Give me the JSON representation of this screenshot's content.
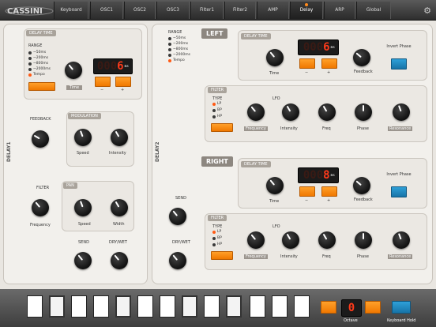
{
  "app": {
    "logo_text": "CASSINI"
  },
  "tabs": [
    {
      "label": "Keyboard",
      "active": false
    },
    {
      "label": "OSC1",
      "active": false
    },
    {
      "label": "OSC2",
      "active": false
    },
    {
      "label": "OSC3",
      "active": false
    },
    {
      "label": "Filter1",
      "active": false
    },
    {
      "label": "Filter2",
      "active": false
    },
    {
      "label": "AMP",
      "active": false
    },
    {
      "label": "Delay",
      "active": true
    },
    {
      "label": "ARP",
      "active": false
    },
    {
      "label": "Global",
      "active": false
    }
  ],
  "delay1": {
    "side_title": "DELAY1",
    "delay_time_header": "DELAY TIME",
    "range_label": "RANGE",
    "range_options": [
      "~50ms",
      "~200ms",
      "~800ms",
      "~2000ms",
      "Tempo"
    ],
    "range_selected": "Tempo",
    "time_label": "Time",
    "time_display_ghost": "000",
    "time_display_value": "6",
    "time_unit": "ms",
    "minus": "−",
    "plus": "+",
    "feedback_label": "FEEDBACK",
    "modulation_header": "MODULATION",
    "speed_label": "Speed",
    "intensity_label": "Intensity",
    "filter_label": "FILTER",
    "frequency_label": "Frequency",
    "pan_header": "PAN",
    "pan_speed_label": "Speed",
    "width_label": "Width",
    "send_label": "SEND",
    "drywet_label": "DRY/WET"
  },
  "delay2": {
    "side_title": "DELAY2",
    "range_label": "RANGE",
    "range_options": [
      "~50ms",
      "~200ms",
      "~800ms",
      "~2000ms",
      "Tempo"
    ],
    "range_selected": "Tempo",
    "send_label": "SEND",
    "drywet_label": "DRY/WET",
    "left": {
      "title": "LEFT",
      "delay_time_header": "DELAY TIME",
      "time_label": "Time",
      "display_ghost": "000",
      "display_value": "6",
      "unit": "ms",
      "minus": "−",
      "plus": "+",
      "feedback_label": "Feedback",
      "invert_phase_label": "Invert Phase",
      "filter_header": "FILTER",
      "type_label": "TYPE",
      "types": [
        "LP",
        "BP",
        "HP"
      ],
      "type_selected": "LP",
      "lfo_label": "LFO",
      "frequency_label": "Frequency",
      "intensity_label": "Intensity",
      "freq_label": "Freq",
      "phase_label": "Phase",
      "resonance_label": "Resonance"
    },
    "right": {
      "title": "RIGHT",
      "delay_time_header": "DELAY TIME",
      "time_label": "Time",
      "display_ghost": "000",
      "display_value": "8",
      "unit": "ms",
      "minus": "−",
      "plus": "+",
      "feedback_label": "Feedback",
      "invert_phase_label": "Invert Phase",
      "filter_header": "FILTER",
      "type_label": "TYPE",
      "types": [
        "LP",
        "BP",
        "HP"
      ],
      "type_selected": "LP",
      "lfo_label": "LFO",
      "frequency_label": "Frequency",
      "intensity_label": "Intensity",
      "freq_label": "Freq",
      "phase_label": "Phase",
      "resonance_label": "Resonance"
    }
  },
  "keyboard": {
    "octave_label": "Octave",
    "octave_value": "0",
    "keyboard_hold_label": "Keyboard Hold"
  },
  "colors": {
    "accent": "#f07800",
    "led": "#ff3a1a",
    "blue": "#1774a8"
  }
}
